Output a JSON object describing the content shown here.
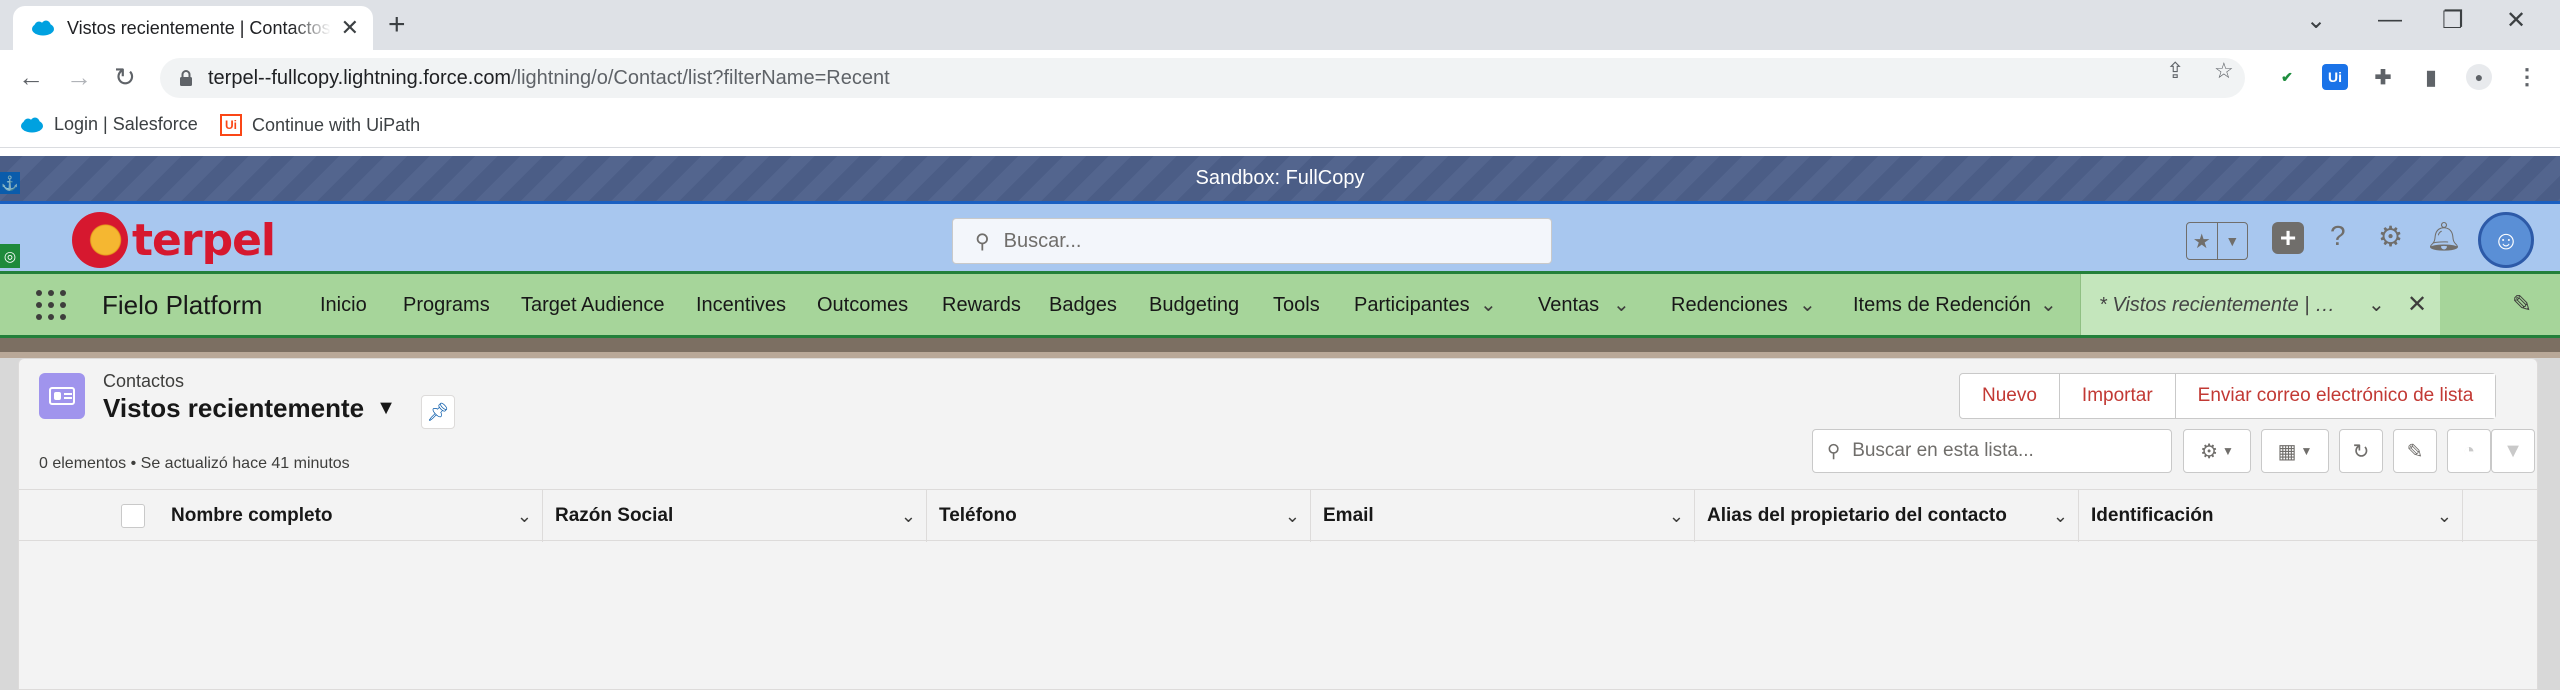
{
  "browser": {
    "tab_title": "Vistos recientemente | Contactos | Salesforce",
    "url_host": "terpel--fullcopy.lightning.force.com",
    "url_path": "/lightning/o/Contact/list?filterName=Recent",
    "bookmarks": [
      {
        "label": "Login | Salesforce",
        "icon": "salesforce-cloud-icon"
      },
      {
        "label": "Continue with UiPath",
        "icon": "uipath-icon"
      }
    ],
    "extension_label": "Ui"
  },
  "sandbox_banner": "Sandbox: FullCopy",
  "header": {
    "logo_text": "terpel",
    "search_placeholder": "Buscar..."
  },
  "app_nav": {
    "app_name": "Fielo Platform",
    "items": [
      {
        "label": "Inicio",
        "dropdown": false
      },
      {
        "label": "Programs",
        "dropdown": false
      },
      {
        "label": "Target Audience",
        "dropdown": false
      },
      {
        "label": "Incentives",
        "dropdown": false
      },
      {
        "label": "Outcomes",
        "dropdown": false
      },
      {
        "label": "Rewards",
        "dropdown": false
      },
      {
        "label": "Badges",
        "dropdown": false
      },
      {
        "label": "Budgeting",
        "dropdown": false
      },
      {
        "label": "Tools",
        "dropdown": false
      },
      {
        "label": "Participantes",
        "dropdown": true
      },
      {
        "label": "Ventas",
        "dropdown": true
      },
      {
        "label": "Redenciones",
        "dropdown": true
      },
      {
        "label": "Items de Redención",
        "dropdown": true
      }
    ],
    "active_tab": "* Vistos recientemente | Contactos"
  },
  "list_view": {
    "object_label": "Contactos",
    "view_name": "Vistos recientemente",
    "actions": [
      "Nuevo",
      "Importar",
      "Enviar correo electrónico de lista"
    ],
    "status": "0 elementos • Se actualizó hace 41 minutos",
    "search_placeholder": "Buscar en esta lista...",
    "columns": [
      "Nombre completo",
      "Razón Social",
      "Teléfono",
      "Email",
      "Alias del propietario del contacto",
      "Identificación"
    ]
  },
  "colors": {
    "header_bg": "#a8c7ef",
    "nav_bg": "#a6d59a",
    "action_text": "#c23934",
    "object_icon": "#a094ed"
  }
}
